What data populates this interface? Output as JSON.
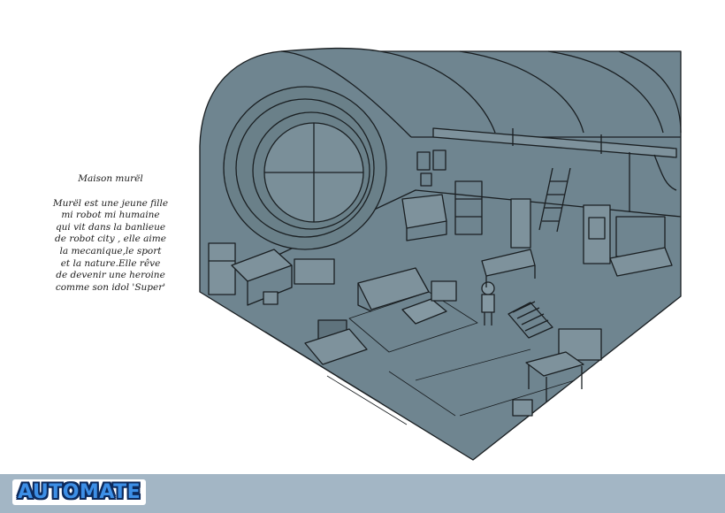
{
  "caption": {
    "title": "Maison murël",
    "description": "Murël est une jeune fille\nmi robot mi humaine\nqui vit dans la banlieue\nde robot city , elle aime\nla mecanique,le sport\net la nature.Elle rêve\nde devenir une heroine\ncomme son idol 'Super'"
  },
  "footer": {
    "logo_text": "AUTOMATE"
  },
  "colors": {
    "room_fill": "#6f8590",
    "line": "#1a1f22",
    "footer_band": "#a3b6c5",
    "logo_fill": "#3d8fe6",
    "logo_outline": "#0d2a5c"
  }
}
